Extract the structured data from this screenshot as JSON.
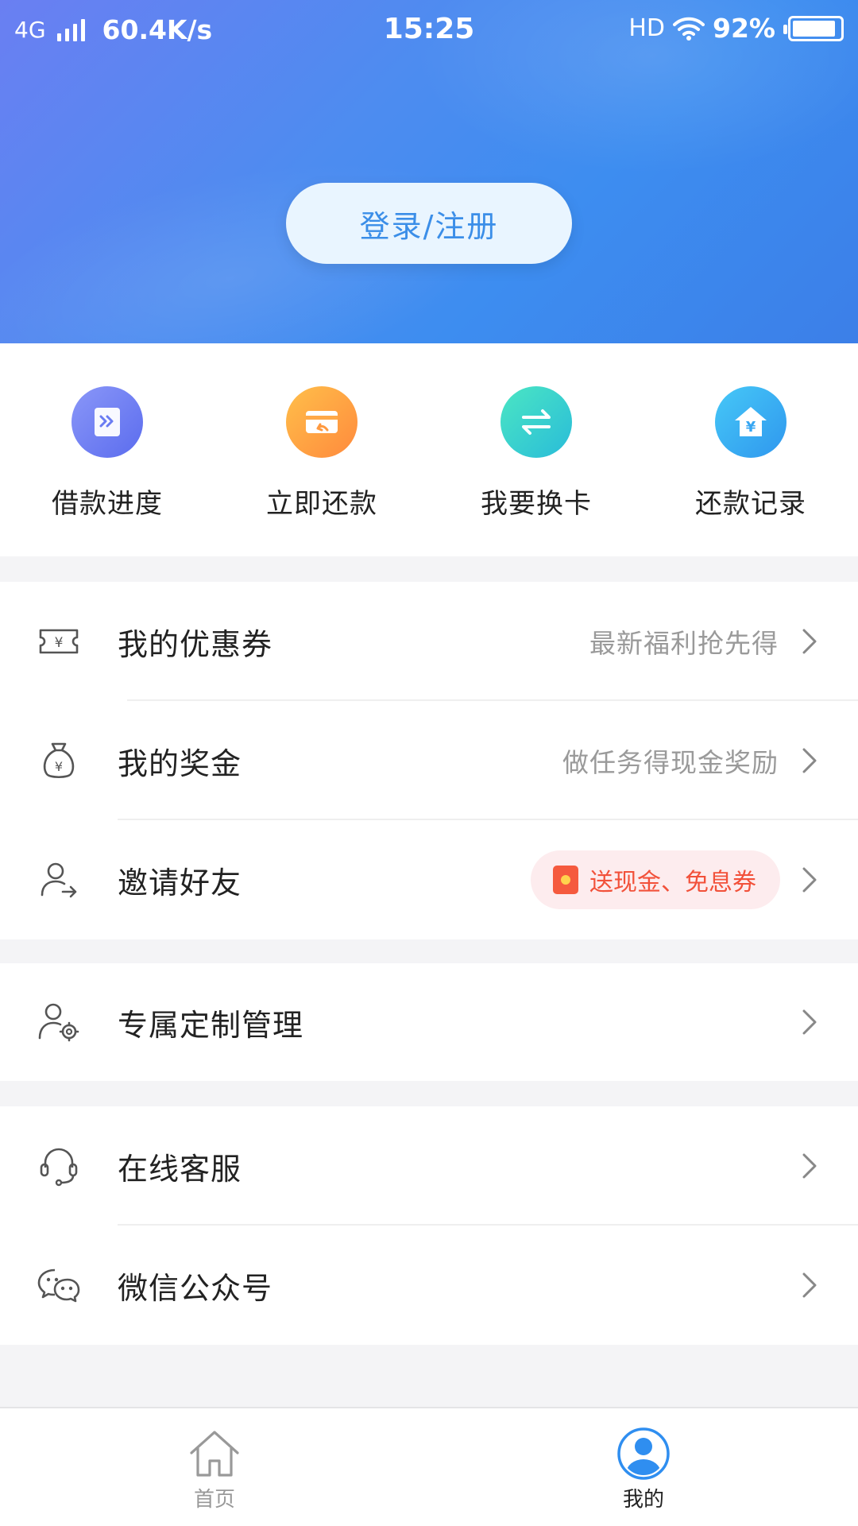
{
  "status_bar": {
    "network": "4G",
    "speed": "60.4K/s",
    "time": "15:25",
    "hd": "HD",
    "battery": "92%",
    "battery_level": 0.92
  },
  "header": {
    "login_label": "登录/注册"
  },
  "shortcuts": [
    {
      "label": "借款进度",
      "icon": "loan-progress-icon",
      "color_from": "#7b8cf7",
      "color_to": "#5a6ef0"
    },
    {
      "label": "立即还款",
      "icon": "repay-icon",
      "color_from": "#ffb347",
      "color_to": "#ff8a3d"
    },
    {
      "label": "我要换卡",
      "icon": "swap-card-icon",
      "color_from": "#3fe0c5",
      "color_to": "#2bc0d8"
    },
    {
      "label": "还款记录",
      "icon": "repay-record-icon",
      "color_from": "#3fc2f5",
      "color_to": "#2f9df0"
    }
  ],
  "menu": {
    "coupons": {
      "title": "我的优惠券",
      "hint": "最新福利抢先得"
    },
    "bonus": {
      "title": "我的奖金",
      "hint": "做任务得现金奖励"
    },
    "invite": {
      "title": "邀请好友",
      "badge": "送现金、免息券"
    },
    "custom": {
      "title": "专属定制管理"
    },
    "service": {
      "title": "在线客服"
    },
    "wechat": {
      "title": "微信公众号"
    }
  },
  "tabbar": {
    "home": "首页",
    "mine": "我的",
    "active_color": "#2f8ef0",
    "inactive_color": "#999999"
  }
}
